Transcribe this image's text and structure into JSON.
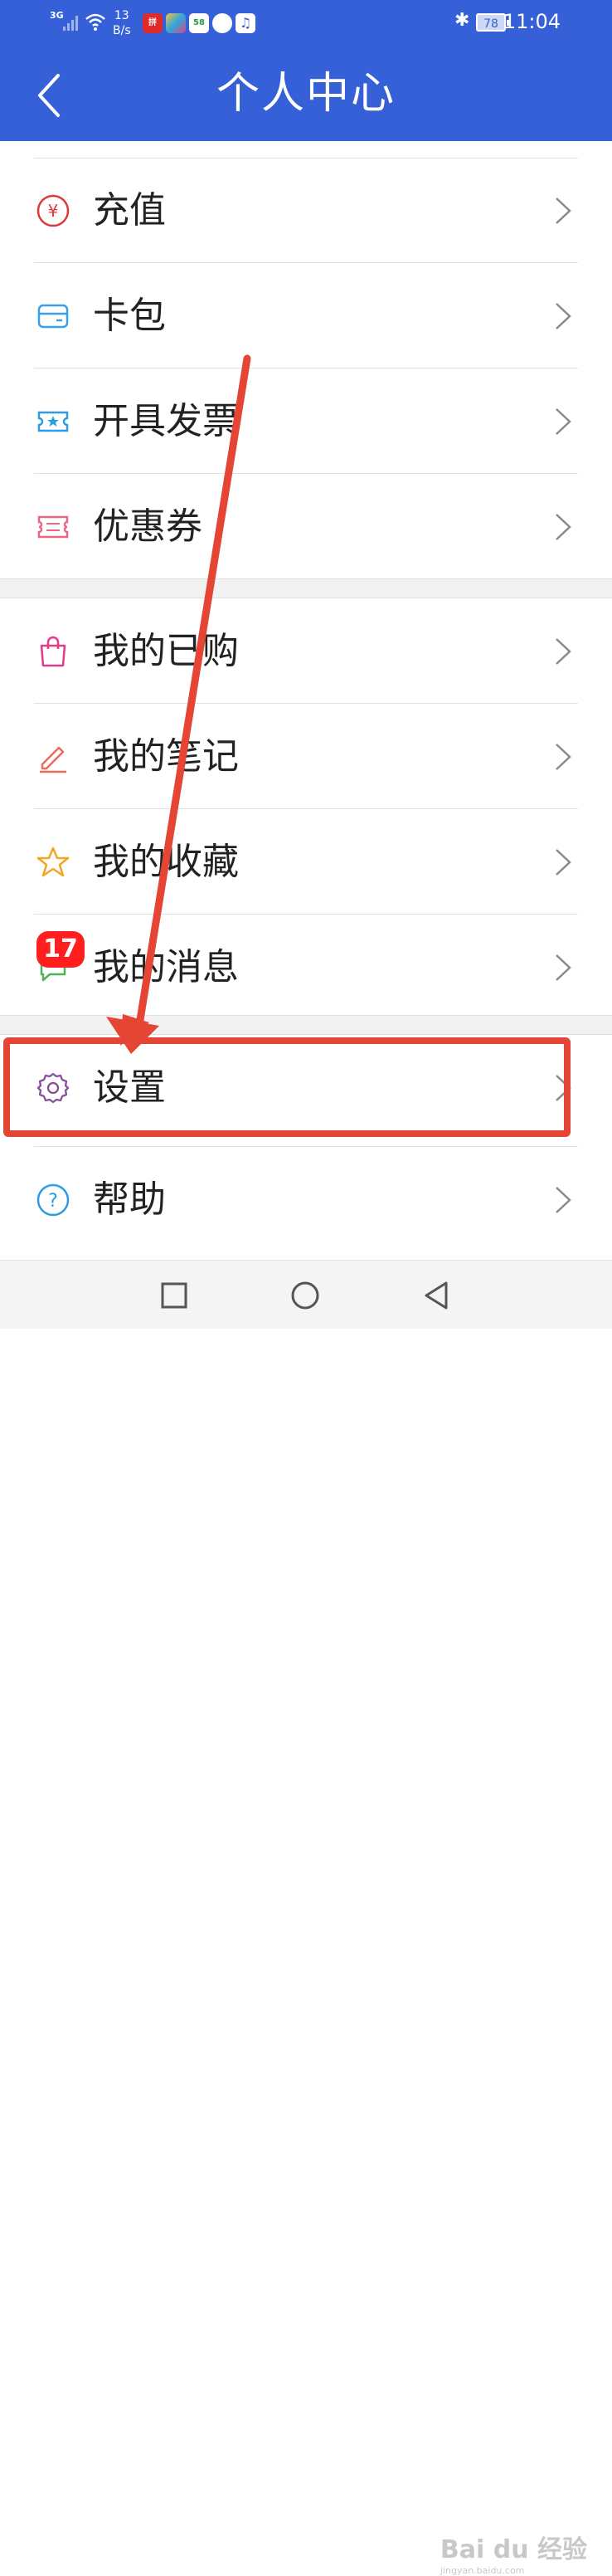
{
  "status_bar": {
    "network": "3G",
    "speed_value": "13",
    "speed_unit": "B/s",
    "battery": "78",
    "time": "11:04",
    "app_icons": [
      {
        "name": "pinduoduo-app-icon",
        "text": "拼",
        "color": "#e02b2b"
      },
      {
        "name": "colorful-app-icon",
        "text": "",
        "color": "#2ba7e0"
      },
      {
        "name": "58-app-icon",
        "text": "58",
        "color": "#ffffff"
      },
      {
        "name": "white-circle-app-icon",
        "text": "",
        "color": "#ffffff"
      },
      {
        "name": "music-app-icon",
        "text": "♫",
        "color": "#ffffff"
      }
    ]
  },
  "header": {
    "title": "个人中心",
    "background": "#3560d8"
  },
  "sections": [
    {
      "items": [
        {
          "id": "recharge",
          "label": "充值",
          "icon": "yuan-circle-icon",
          "color": "#e0383d"
        },
        {
          "id": "card-wallet",
          "label": "卡包",
          "icon": "card-icon",
          "color": "#3a9ee8"
        },
        {
          "id": "invoice",
          "label": "开具发票",
          "icon": "ticket-star-icon",
          "color": "#2e9de0"
        },
        {
          "id": "coupon",
          "label": "优惠券",
          "icon": "coupon-icon",
          "color": "#e26a86"
        }
      ]
    },
    {
      "items": [
        {
          "id": "purchased",
          "label": "我的已购",
          "icon": "shopping-bag-icon",
          "color": "#e23a8a"
        },
        {
          "id": "notes",
          "label": "我的笔记",
          "icon": "pencil-icon",
          "color": "#f06a5a"
        },
        {
          "id": "favorites",
          "label": "我的收藏",
          "icon": "star-icon",
          "color": "#f2a623"
        },
        {
          "id": "messages",
          "label": "我的消息",
          "icon": "chat-bubble-icon",
          "color": "#4cb35a",
          "badge": "17"
        }
      ]
    },
    {
      "items": [
        {
          "id": "settings",
          "label": "设置",
          "icon": "gear-icon",
          "color": "#8a4f9c"
        },
        {
          "id": "help",
          "label": "帮助",
          "icon": "question-circle-icon",
          "color": "#2e9de0"
        }
      ]
    }
  ],
  "annotation": {
    "highlight_color": "#e44535"
  },
  "nav_bar": {
    "buttons": [
      "recent-apps",
      "home",
      "back"
    ]
  },
  "watermark": {
    "text": "Bai du 经验",
    "sub": "jingyan.baidu.com"
  }
}
